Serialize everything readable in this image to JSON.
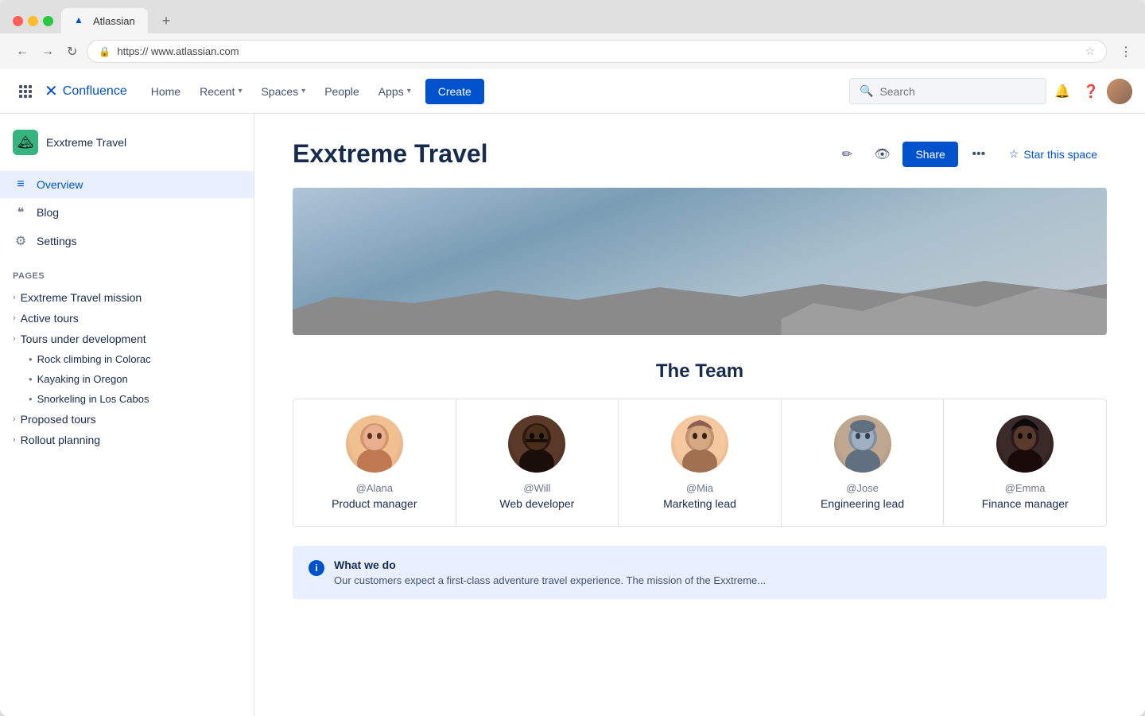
{
  "browser": {
    "url": "https:// www.atlassian.com",
    "tab_title": "Atlassian",
    "new_tab": "+"
  },
  "nav": {
    "logo_text": "Confluence",
    "home": "Home",
    "recent": "Recent",
    "spaces": "Spaces",
    "people": "People",
    "apps": "Apps",
    "create": "Create",
    "search_placeholder": "Search"
  },
  "sidebar": {
    "space_name": "Exxtreme Travel",
    "overview": "Overview",
    "blog": "Blog",
    "settings": "Settings",
    "pages_label": "PAGES",
    "pages": [
      {
        "label": "Exxtreme Travel mission",
        "indent": 0
      },
      {
        "label": "Active tours",
        "indent": 0
      },
      {
        "label": "Tours under development",
        "indent": 0
      },
      {
        "label": "Rock climbing in Colorac",
        "indent": 1
      },
      {
        "label": "Kayaking in Oregon",
        "indent": 1
      },
      {
        "label": "Snorkeling in Los Cabos",
        "indent": 1
      },
      {
        "label": "Proposed tours",
        "indent": 0
      },
      {
        "label": "Rollout planning",
        "indent": 0
      }
    ]
  },
  "page": {
    "title": "Exxtreme Travel",
    "star_space": "Star this space",
    "share": "Share",
    "team_title": "The Team",
    "team_members": [
      {
        "username": "@Alana",
        "role": "Product manager"
      },
      {
        "username": "@Will",
        "role": "Web developer"
      },
      {
        "username": "@Mia",
        "role": "Marketing lead"
      },
      {
        "username": "@Jose",
        "role": "Engineering lead"
      },
      {
        "username": "@Emma",
        "role": "Finance manager"
      }
    ],
    "info_title": "What we do",
    "info_text": "Our customers expect a first-class adventure travel experience. The mission of the Exxtreme..."
  }
}
